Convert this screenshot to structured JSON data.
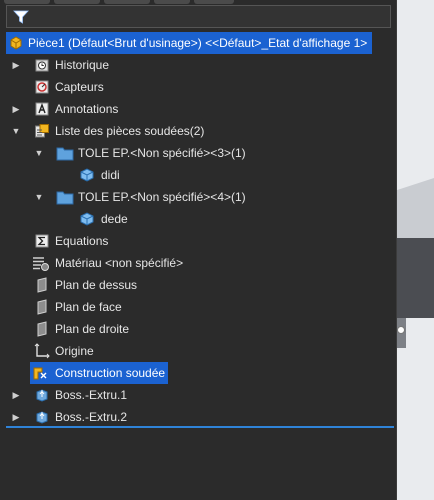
{
  "root": {
    "label": "Pièce1 (Défaut<Brut d'usinage>) <<Défaut>_Etat d'affichage 1>"
  },
  "items": [
    {
      "label": "Historique"
    },
    {
      "label": "Capteurs"
    },
    {
      "label": "Annotations"
    },
    {
      "label": "Liste des pièces soudées(2)"
    },
    {
      "label": "TOLE EP.<Non spécifié><3>(1)"
    },
    {
      "label": "didi"
    },
    {
      "label": "TOLE EP.<Non spécifié><4>(1)"
    },
    {
      "label": "dede"
    },
    {
      "label": "Equations"
    },
    {
      "label": "Matériau <non spécifié>"
    },
    {
      "label": "Plan de dessus"
    },
    {
      "label": "Plan de face"
    },
    {
      "label": "Plan de droite"
    },
    {
      "label": "Origine"
    },
    {
      "label": "Construction soudée"
    },
    {
      "label": "Boss.-Extru.1"
    },
    {
      "label": "Boss.-Extru.2"
    }
  ],
  "colors": {
    "selection": "#1b62d1",
    "panel": "#2b2b2b",
    "divider": "#2f83d8"
  }
}
